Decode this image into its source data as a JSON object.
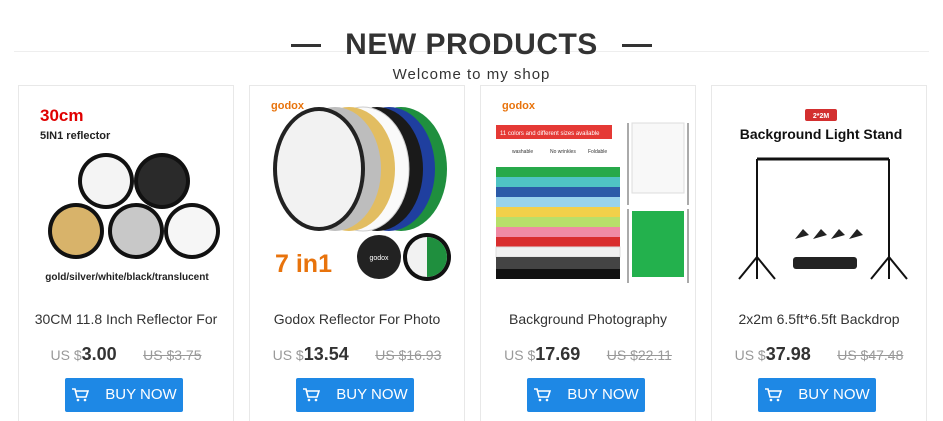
{
  "section": {
    "title": "NEW PRODUCTS",
    "subtitle": "Welcome to my shop"
  },
  "colors": {
    "button": "#1e88e5",
    "text": "#333333",
    "muted": "#999999",
    "brand_orange": "#e8730c",
    "red": "#e00000"
  },
  "products": [
    {
      "name": "30CM 11.8 Inch Reflector For",
      "currency": "US $",
      "price": "3.00",
      "old_price": "US $3.75",
      "buy_label": "BUY NOW",
      "image_text": {
        "size": "30cm",
        "type": "5IN1 reflector",
        "colors": "gold/silver/white/black/translucent"
      }
    },
    {
      "name": "Godox Reflector For Photo",
      "currency": "US $",
      "price": "13.54",
      "old_price": "US $16.93",
      "buy_label": "BUY NOW",
      "image_text": {
        "brand": "godox",
        "badge": "7 in1",
        "brand_small": "godox"
      }
    },
    {
      "name": "Background Photography",
      "currency": "US $",
      "price": "17.69",
      "old_price": "US $22.11",
      "buy_label": "BUY NOW",
      "image_text": {
        "brand": "godox",
        "banner": "11 colors and different sizes available",
        "f1": "washable",
        "f2": "No wrinkles",
        "f3": "Foldable"
      }
    },
    {
      "name": "2x2m 6.5ft*6.5ft Backdrop",
      "currency": "US $",
      "price": "37.98",
      "old_price": "US $47.48",
      "buy_label": "BUY NOW",
      "image_text": {
        "badge": "2*2M",
        "title": "Background Light Stand"
      }
    }
  ]
}
